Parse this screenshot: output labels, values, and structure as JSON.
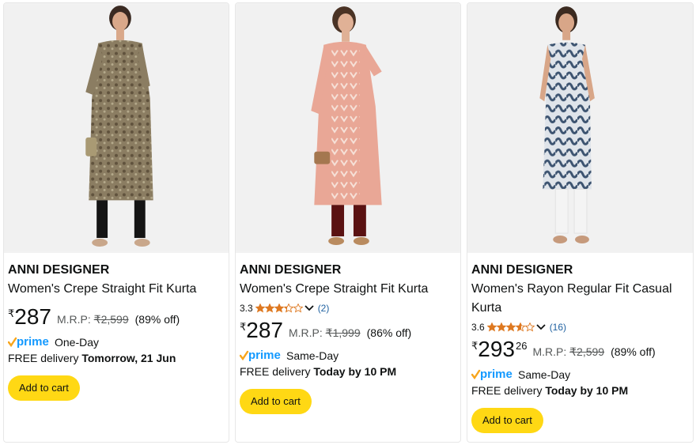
{
  "products": [
    {
      "brand": "ANNI DESIGNER",
      "title": "Women's Crepe Straight Fit Kurta",
      "rating": null,
      "rating_count": null,
      "currency": "₹",
      "price_whole": "287",
      "price_fraction": "",
      "mrp_label": "M.R.P:",
      "mrp": "₹2,599",
      "discount": "(89% off)",
      "prime_label": "prime",
      "prime_speed": "One-Day",
      "delivery_prefix": "FREE delivery",
      "delivery_date": "Tomorrow, 21 Jun",
      "cta": "Add to cart",
      "image_icon": "kurta-product-image"
    },
    {
      "brand": "ANNI DESIGNER",
      "title": "Women's Crepe Straight Fit Kurta",
      "rating": "3.3",
      "rating_value": 3.3,
      "rating_count": "(2)",
      "currency": "₹",
      "price_whole": "287",
      "price_fraction": "",
      "mrp_label": "M.R.P:",
      "mrp": "₹1,999",
      "discount": "(86% off)",
      "prime_label": "prime",
      "prime_speed": "Same-Day",
      "delivery_prefix": "FREE delivery",
      "delivery_date": "Today by 10 PM",
      "cta": "Add to cart",
      "image_icon": "kurta-product-image"
    },
    {
      "brand": "ANNI DESIGNER",
      "title": "Women's Rayon Regular Fit Casual Kurta",
      "rating": "3.6",
      "rating_value": 3.6,
      "rating_count": "(16)",
      "currency": "₹",
      "price_whole": "293",
      "price_fraction": "26",
      "mrp_label": "M.R.P:",
      "mrp": "₹2,599",
      "discount": "(89% off)",
      "prime_label": "prime",
      "prime_speed": "Same-Day",
      "delivery_prefix": "FREE delivery",
      "delivery_date": "Today by 10 PM",
      "cta": "Add to cart",
      "image_icon": "kurta-product-image"
    }
  ],
  "colors": {
    "cta_bg": "#ffd814",
    "star": "#de7921",
    "link": "#2162a1",
    "prime_check": "#f7a51c",
    "prime_text": "#1399ff",
    "muted": "#565959"
  }
}
